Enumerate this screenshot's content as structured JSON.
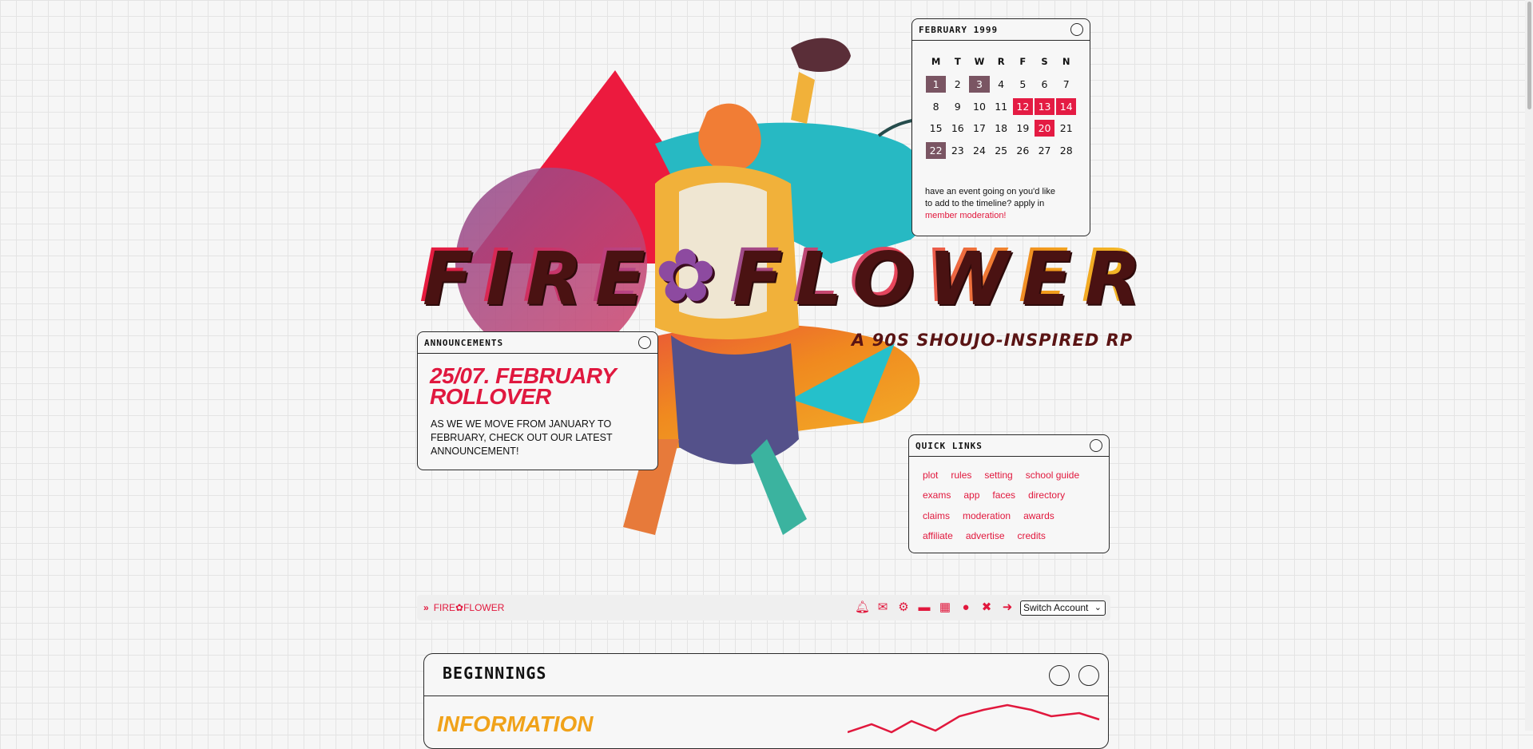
{
  "colors": {
    "accent": "#e1183d",
    "past_day": "#7a5563",
    "highlight_day": "#e41b43",
    "info": "#f0a21a"
  },
  "hero": {
    "title_part1": "FIRE",
    "title_mark": "✿",
    "title_part2": "FLOWER",
    "tagline": "A 90S SHOUJO-INSPIRED RP"
  },
  "calendar": {
    "title": "FEBRUARY 1999",
    "day_headers": [
      "M",
      "T",
      "W",
      "R",
      "F",
      "S",
      "N"
    ],
    "weeks": [
      [
        "1",
        "2",
        "3",
        "4",
        "5",
        "6",
        "7"
      ],
      [
        "8",
        "9",
        "10",
        "11",
        "12",
        "13",
        "14"
      ],
      [
        "15",
        "16",
        "17",
        "18",
        "19",
        "20",
        "21"
      ],
      [
        "22",
        "23",
        "24",
        "25",
        "26",
        "27",
        "28"
      ]
    ],
    "past_days": [
      "1",
      "3",
      "22"
    ],
    "highlight_days": [
      "12",
      "13",
      "14",
      "20"
    ],
    "note_text": "have an event going on you'd like to add to the timeline? apply in",
    "note_link": "member moderation!"
  },
  "announcements": {
    "title": "ANNOUNCEMENTS",
    "heading": "25/07. FEBRUARY ROLLOVER",
    "body": "AS WE WE MOVE FROM JANUARY TO FEBRUARY, CHECK OUT OUR LATEST ANNOUNCEMENT!"
  },
  "quick_links": {
    "title": "QUICK LINKS",
    "rows": [
      [
        "plot",
        "rules",
        "setting",
        "school guide"
      ],
      [
        "exams",
        "app",
        "faces",
        "directory"
      ],
      [
        "claims",
        "moderation",
        "awards"
      ],
      [
        "affiliate",
        "advertise",
        "credits"
      ]
    ]
  },
  "navbar": {
    "crumb_marker": "»",
    "crumb": "FIRE✿FLOWER",
    "icons": [
      "bell-icon",
      "envelope-icon",
      "gear-icon",
      "card-icon",
      "calendar-icon",
      "user-icon",
      "tools-icon",
      "logout-icon"
    ],
    "switch_account": "Switch Account"
  },
  "category": {
    "title": "BEGINNINGS",
    "info_title": "INFORMATION"
  }
}
